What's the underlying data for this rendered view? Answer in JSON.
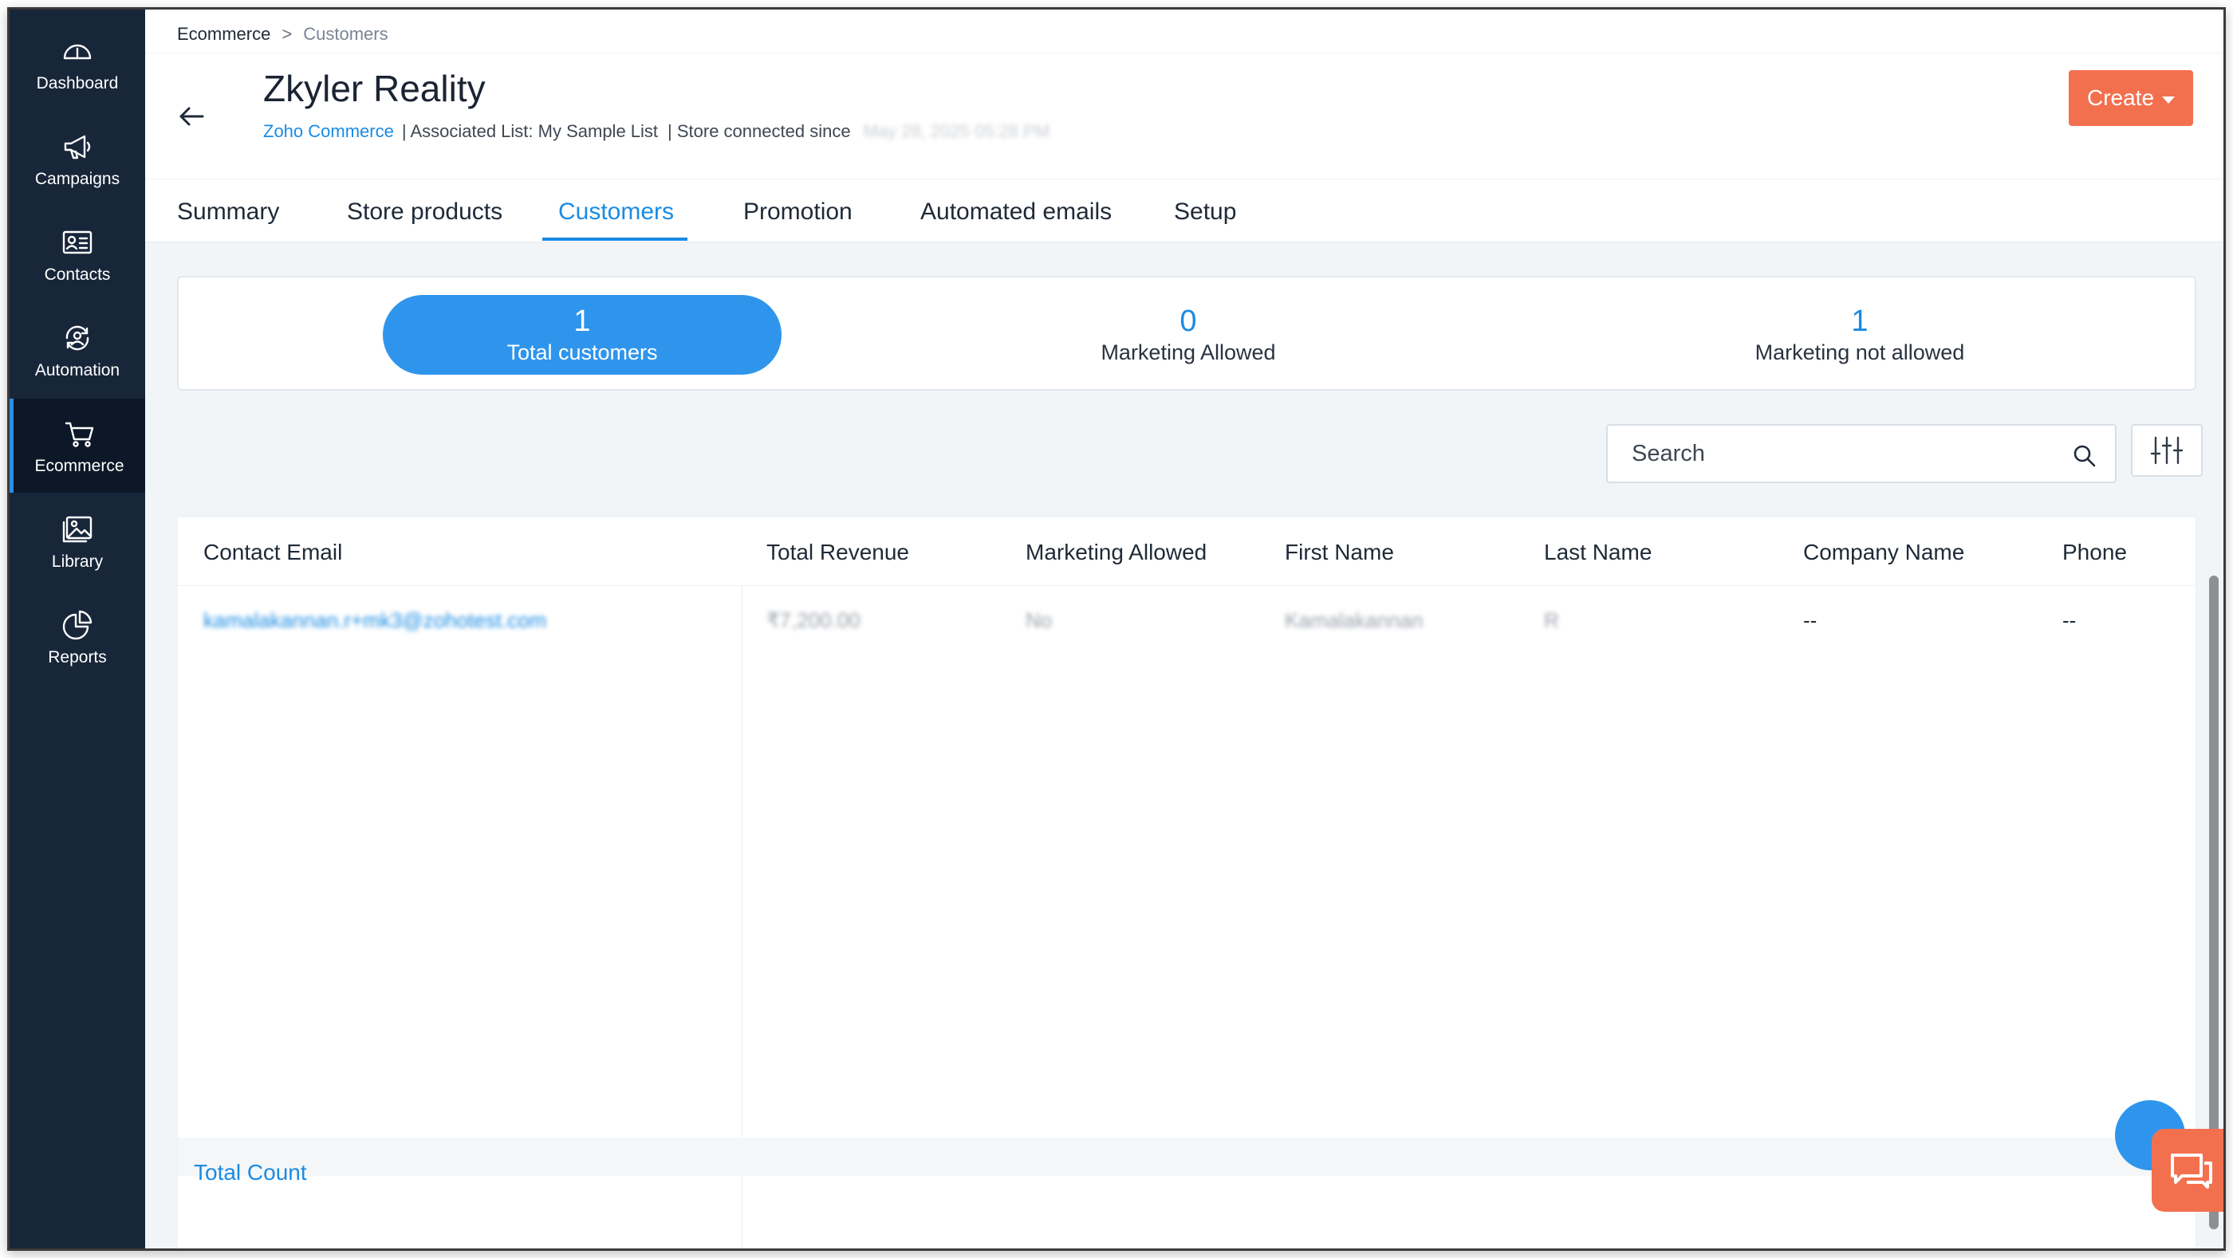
{
  "sidebar": {
    "items": [
      {
        "label": "Dashboard",
        "icon": "dashboard-icon"
      },
      {
        "label": "Campaigns",
        "icon": "megaphone-icon"
      },
      {
        "label": "Contacts",
        "icon": "contact-card-icon"
      },
      {
        "label": "Automation",
        "icon": "automation-icon"
      },
      {
        "label": "Ecommerce",
        "icon": "cart-icon",
        "active": true
      },
      {
        "label": "Library",
        "icon": "image-library-icon"
      },
      {
        "label": "Reports",
        "icon": "pie-chart-icon"
      }
    ]
  },
  "breadcrumb": {
    "root": "Ecommerce",
    "separator": ">",
    "current": "Customers"
  },
  "store": {
    "title": "Zkyler Reality",
    "platform_link": "Zoho Commerce",
    "associated_list": "| Associated List: My Sample List",
    "connected_since_label": "| Store connected since",
    "connected_since_value": "May 28, 2025 05:28 PM"
  },
  "create_button": {
    "label": "Create"
  },
  "tabs": [
    {
      "label": "Summary"
    },
    {
      "label": "Store products"
    },
    {
      "label": "Customers",
      "active": true
    },
    {
      "label": "Promotion"
    },
    {
      "label": "Automated emails"
    },
    {
      "label": "Setup"
    }
  ],
  "stats": [
    {
      "value": "1",
      "label": "Total customers",
      "selected": true
    },
    {
      "value": "0",
      "label": "Marketing Allowed"
    },
    {
      "value": "1",
      "label": "Marketing not allowed"
    }
  ],
  "search": {
    "placeholder": "Search"
  },
  "table": {
    "headers": [
      "Contact Email",
      "Total Revenue",
      "Marketing Allowed",
      "First Name",
      "Last Name",
      "Company Name",
      "Phone"
    ],
    "rows": [
      {
        "email": "kamalakannan.r+mk3@zohotest.com",
        "revenue": "₹7,200.00",
        "marketing": "No",
        "first_name": "Kamalakannan",
        "last_name": "R",
        "company": "--",
        "phone": "--"
      }
    ],
    "total_count_label": "Total Count"
  },
  "colors": {
    "sidebar": "#18263a",
    "accent": "#1a8be3",
    "selected_stat": "#2f95ec",
    "create": "#f3704f"
  }
}
